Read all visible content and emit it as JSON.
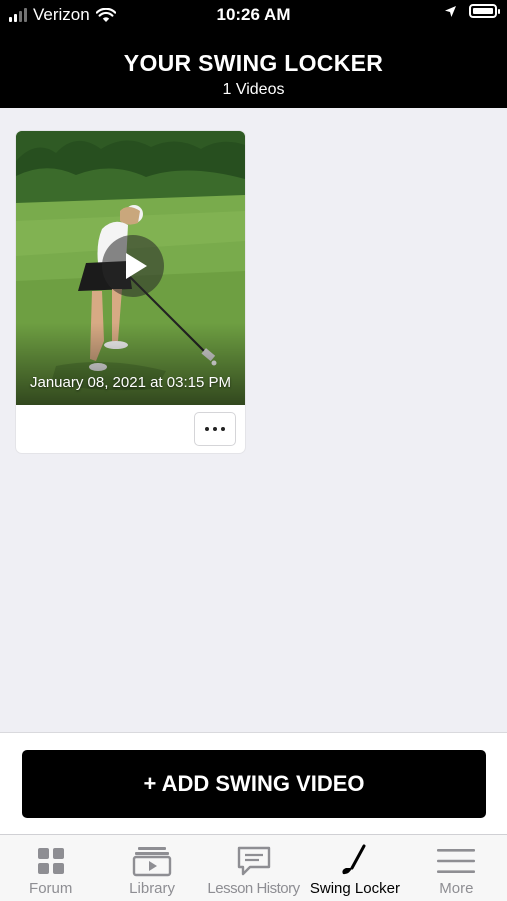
{
  "status_bar": {
    "carrier": "Verizon",
    "time": "10:26 AM",
    "icons": [
      "signal-icon",
      "wifi-icon",
      "location-arrow-icon",
      "battery-icon"
    ]
  },
  "header": {
    "title": "YOUR SWING LOCKER",
    "subtitle": "1 Videos"
  },
  "videos": [
    {
      "date": "January 08, 2021 at 03:15 PM"
    }
  ],
  "add_button": {
    "label": "+ ADD SWING VIDEO"
  },
  "tabs": [
    {
      "label": "Forum",
      "icon": "grid-icon",
      "active": false
    },
    {
      "label": "Library",
      "icon": "video-library-icon",
      "active": false
    },
    {
      "label": "Lesson History",
      "icon": "chat-bubble-icon",
      "active": false
    },
    {
      "label": "Swing Locker",
      "icon": "golf-club-icon",
      "active": true
    },
    {
      "label": "More",
      "icon": "menu-icon",
      "active": false
    }
  ],
  "colors": {
    "header_bg": "#000000",
    "page_bg": "#efeff4",
    "tab_inactive": "#8e8e93",
    "tab_active": "#000000"
  }
}
